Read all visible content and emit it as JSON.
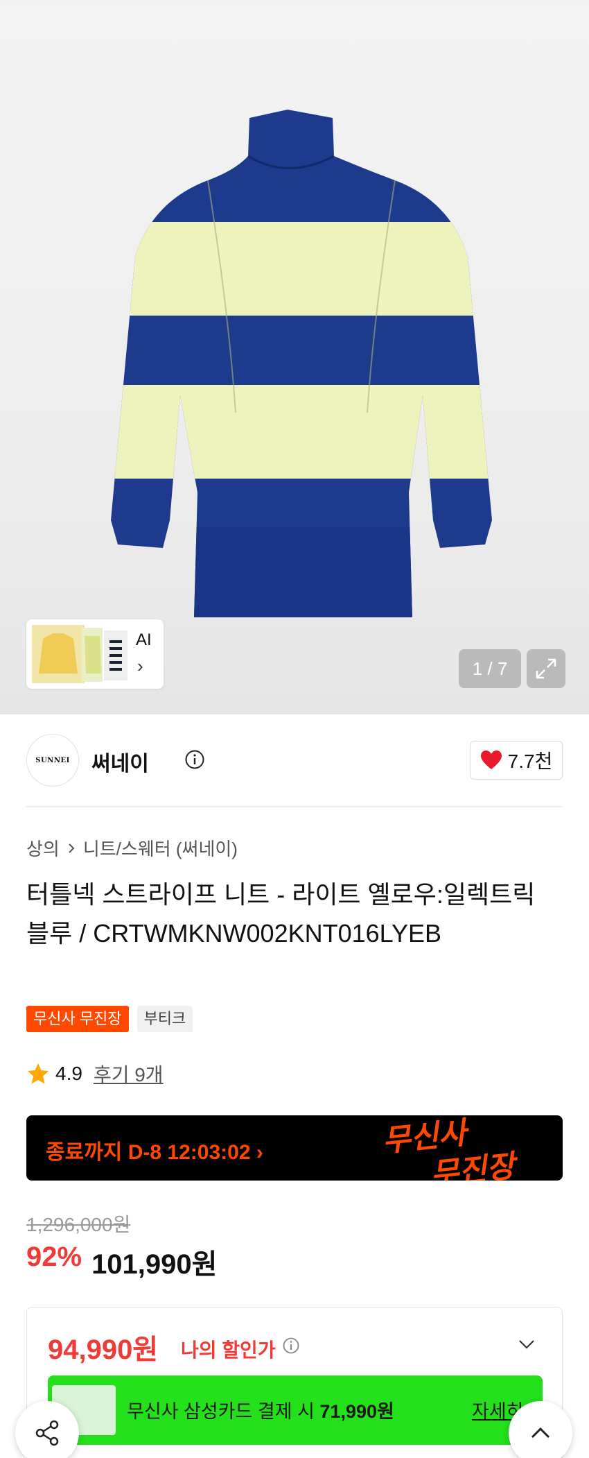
{
  "gallery": {
    "ai_label": "AI",
    "counter": "1 / 7",
    "colors": {
      "navy": "#1d3a8c",
      "cream": "#eef2bd"
    }
  },
  "brand": {
    "logo_text": "SUNNEI",
    "name": "써네이",
    "likes": "7.7천"
  },
  "breadcrumb": {
    "category": "상의",
    "subcategory": "니트/스웨터 (써네이)"
  },
  "product": {
    "title": "터틀넥 스트라이프 니트 - 라이트 옐로우:일렉트릭 블루 / CRTWMKNW002KNT016LYEB"
  },
  "badges": [
    "무신사 무진장",
    "부티크"
  ],
  "rating": {
    "score": "4.9",
    "review_text": "후기 9개"
  },
  "banner": {
    "countdown": "종료까지 D-8 12:03:02 ›",
    "logo_line1": "무신사",
    "logo_line2": "무진장"
  },
  "pricing": {
    "original_price": "1,296,000원",
    "discount_rate": "92%",
    "sale_price": "101,990원",
    "my_price": "94,990원",
    "my_price_label": "나의 할인가"
  },
  "card_promo": {
    "text_prefix": "무신사 삼성카드 결제 시 ",
    "text_price": "71,990원",
    "detail_link": "자세히"
  },
  "accent_colors": {
    "red": "#f03a35",
    "orange": "#ff4800",
    "green": "#23e01a"
  }
}
